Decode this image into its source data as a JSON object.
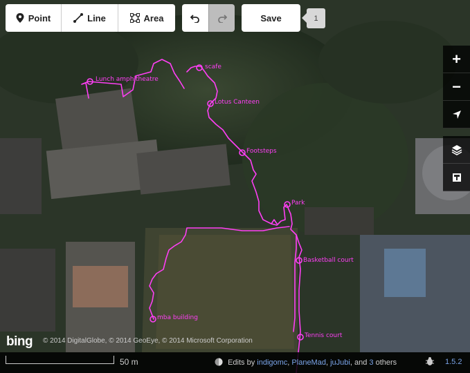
{
  "toolbar": {
    "point_label": "Point",
    "line_label": "Line",
    "area_label": "Area",
    "save_label": "Save",
    "save_count": "1"
  },
  "map": {
    "pois": [
      {
        "label": "Lunch amphitheatre"
      },
      {
        "label": "scafe"
      },
      {
        "label": "Lotus Canteen"
      },
      {
        "label": "Footsteps"
      },
      {
        "label": "Park"
      },
      {
        "label": "Basketball court"
      },
      {
        "label": "mba building"
      },
      {
        "label": "Tennis court"
      }
    ],
    "track_color": "#ff3ff5"
  },
  "map_controls": {
    "zoom_in": "+",
    "zoom_out": "−"
  },
  "imagery": {
    "provider_logo": "bing",
    "copyright": "© 2014 DigitalGlobe, © 2014 GeoEye, © 2014 Microsoft Corporation"
  },
  "footer": {
    "scale_label": "50 m",
    "edits_prefix": "Edits by",
    "contributors": [
      "indigomc",
      "PlaneMad",
      "juJubi"
    ],
    "and_text": "and",
    "others_count": "3",
    "others_text": "others",
    "version": "1.5.2"
  },
  "icons": {
    "point": "point-icon",
    "line": "line-icon",
    "area": "area-icon",
    "undo": "undo-icon",
    "redo": "redo-icon",
    "geolocate": "geolocate-icon",
    "layers": "layers-icon",
    "map-data": "map-data-icon",
    "bug": "bug-icon",
    "globe": "globe-icon"
  }
}
